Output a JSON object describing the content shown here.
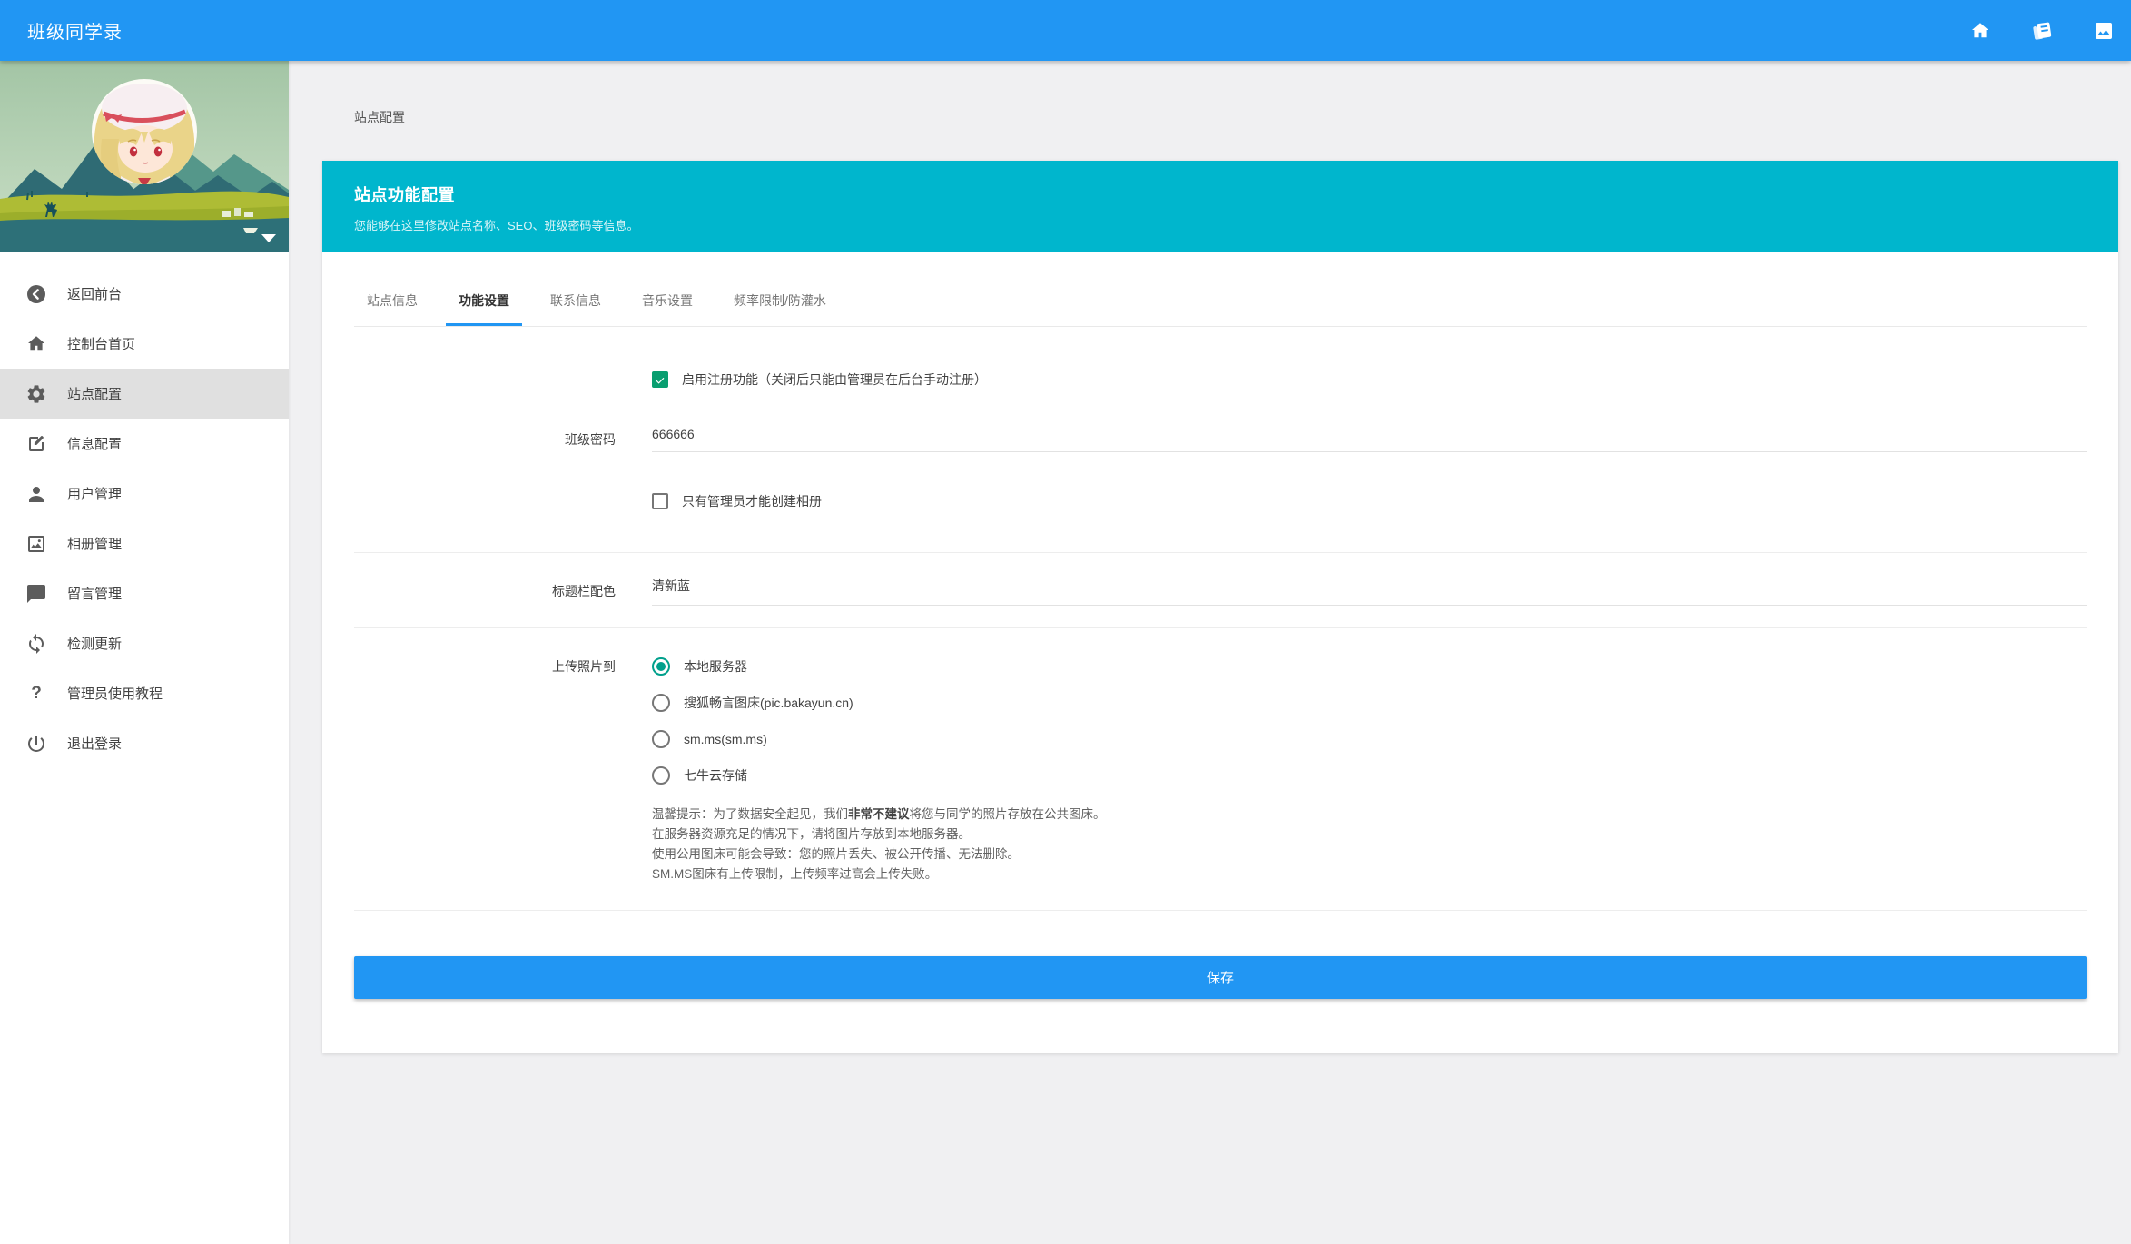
{
  "topbar": {
    "title": "班级同学录",
    "icons": [
      "home",
      "book",
      "image"
    ]
  },
  "sidebar": {
    "items": [
      {
        "icon": "back-circle",
        "label": "返回前台"
      },
      {
        "icon": "home",
        "label": "控制台首页"
      },
      {
        "icon": "gear",
        "label": "站点配置",
        "active": true
      },
      {
        "icon": "edit",
        "label": "信息配置"
      },
      {
        "icon": "user",
        "label": "用户管理"
      },
      {
        "icon": "photo",
        "label": "相册管理"
      },
      {
        "icon": "comment",
        "label": "留言管理"
      },
      {
        "icon": "sync",
        "label": "检测更新"
      },
      {
        "icon": "question",
        "label": "管理员使用教程",
        "glyph": "?"
      },
      {
        "icon": "power",
        "label": "退出登录"
      }
    ]
  },
  "breadcrumb": "站点配置",
  "panel": {
    "title": "站点功能配置",
    "subtitle": "您能够在这里修改站点名称、SEO、班级密码等信息。"
  },
  "tabs": {
    "active_index": 1,
    "items": [
      {
        "label": "站点信息"
      },
      {
        "label": "功能设置"
      },
      {
        "label": "联系信息"
      },
      {
        "label": "音乐设置"
      },
      {
        "label": "频率限制/防灌水"
      }
    ]
  },
  "form": {
    "register": {
      "checked": true,
      "label": "启用注册功能（关闭后只能由管理员在后台手动注册）"
    },
    "class_password": {
      "label": "班级密码",
      "value": "666666"
    },
    "album_admin_only": {
      "checked": false,
      "label": "只有管理员才能创建相册"
    },
    "title_color": {
      "label": "标题栏配色",
      "value": "清新蓝"
    },
    "upload": {
      "label": "上传照片到",
      "options": [
        {
          "label": "本地服务器",
          "selected": true
        },
        {
          "label": "搜狐畅言图床(pic.bakayun.cn)",
          "selected": false
        },
        {
          "label": "sm.ms(sm.ms)",
          "selected": false
        },
        {
          "label": "七牛云存储",
          "selected": false
        }
      ]
    },
    "warning": {
      "line1_prefix": "温馨提示：为了数据安全起见，我们",
      "line1_bold": "非常不建议",
      "line1_suffix": "将您与同学的照片存放在公共图床。",
      "line2": "在服务器资源充足的情况下，请将图片存放到本地服务器。",
      "line3": "使用公用图床可能会导致：您的照片丢失、被公开传播、无法删除。",
      "line4": "SM.MS图床有上传限制，上传频率过高会上传失败。"
    }
  },
  "save_button": {
    "label": "保存"
  },
  "colors": {
    "topbar": "#2196f3",
    "panel": "#00b6cd",
    "green": "#099e70",
    "teal": "#00a08c",
    "save": "#2196f3",
    "active": "#e0e0e0"
  }
}
